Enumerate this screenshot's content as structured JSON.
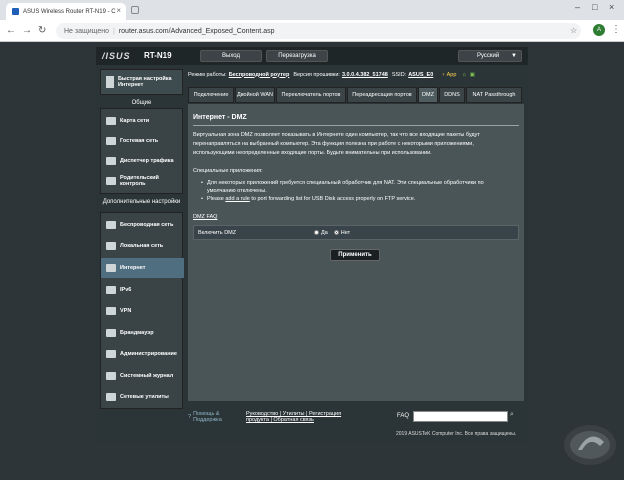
{
  "browser": {
    "tab_title": "ASUS Wireless Router RT-N19 - C",
    "secure_label": "Не защищено",
    "url": "router.asus.com/Advanced_Exposed_Content.asp",
    "avatar_letter": "A"
  },
  "router": {
    "logo": "/ISUS",
    "model": "RT-N19",
    "logout": "Выход",
    "reboot": "Перезагрузка",
    "language": "Русский"
  },
  "sidebar": {
    "quick": "Быстрая настройка Интернет",
    "general_head": "Общие",
    "general": [
      {
        "label": "Карта сети"
      },
      {
        "label": "Гостевая сеть"
      },
      {
        "label": "Диспетчер трафика"
      },
      {
        "label": "Родительский контроль"
      }
    ],
    "advanced_head": "Дополнительные настройки",
    "advanced": [
      {
        "label": "Беспроводная сеть"
      },
      {
        "label": "Локальная сеть"
      },
      {
        "label": "Интернет"
      },
      {
        "label": "IPv6"
      },
      {
        "label": "VPN"
      },
      {
        "label": "Брандмауэр"
      },
      {
        "label": "Администрирование"
      },
      {
        "label": "Системный журнал"
      },
      {
        "label": "Сетевые утилиты"
      }
    ]
  },
  "infobar": {
    "mode_label": "Режим работы:",
    "mode_value": "Беспроводной роутер",
    "fw_label": "Версия прошивки:",
    "fw_value": "3.0.0.4.382_51748",
    "ssid_label": "SSID:",
    "ssid_value": "ASUS_E0",
    "app": "App"
  },
  "tabs": [
    "Подключение",
    "Двойной WAN",
    "Переключатель портов",
    "Переадресация портов",
    "DMZ",
    "DDNS",
    "NAT Passthrough"
  ],
  "content": {
    "title": "Интернет - DMZ",
    "description": "Виртуальная зона DMZ позволяет показывать в Интернете один компьютер, так что все входящие пакеты будут перенаправляться на выбранный компьютер. Эта функция полезна при работе с некоторыми приложениями, использующими неопределенные входящие порты. Будьте внимательны при использовании.",
    "special_label": "Специальные приложения:",
    "bullet1": "Для некоторых приложений требуется специальный обработчик для NAT. Эти специальные обработчики по умолчанию отключены.",
    "bullet2_prefix": "Please",
    "bullet2_link": "add a rule",
    "bullet2_suffix": "to port forwarding list for USB Disk access properly on FTP service.",
    "faq_link": "DMZ  FAQ",
    "enable_label": "Включить DMZ",
    "yes": "Да",
    "no": "Нет",
    "selected": "no",
    "apply": "Применить"
  },
  "footer": {
    "help": "Помощь & Поддержка",
    "links_line1": "Руководство | Утилиты | Регистрация",
    "links_line2": "продукта | Обратная связь",
    "faq": "FAQ",
    "copyright": "2019 ASUSTeK Computer Inc. Все права защищены."
  }
}
